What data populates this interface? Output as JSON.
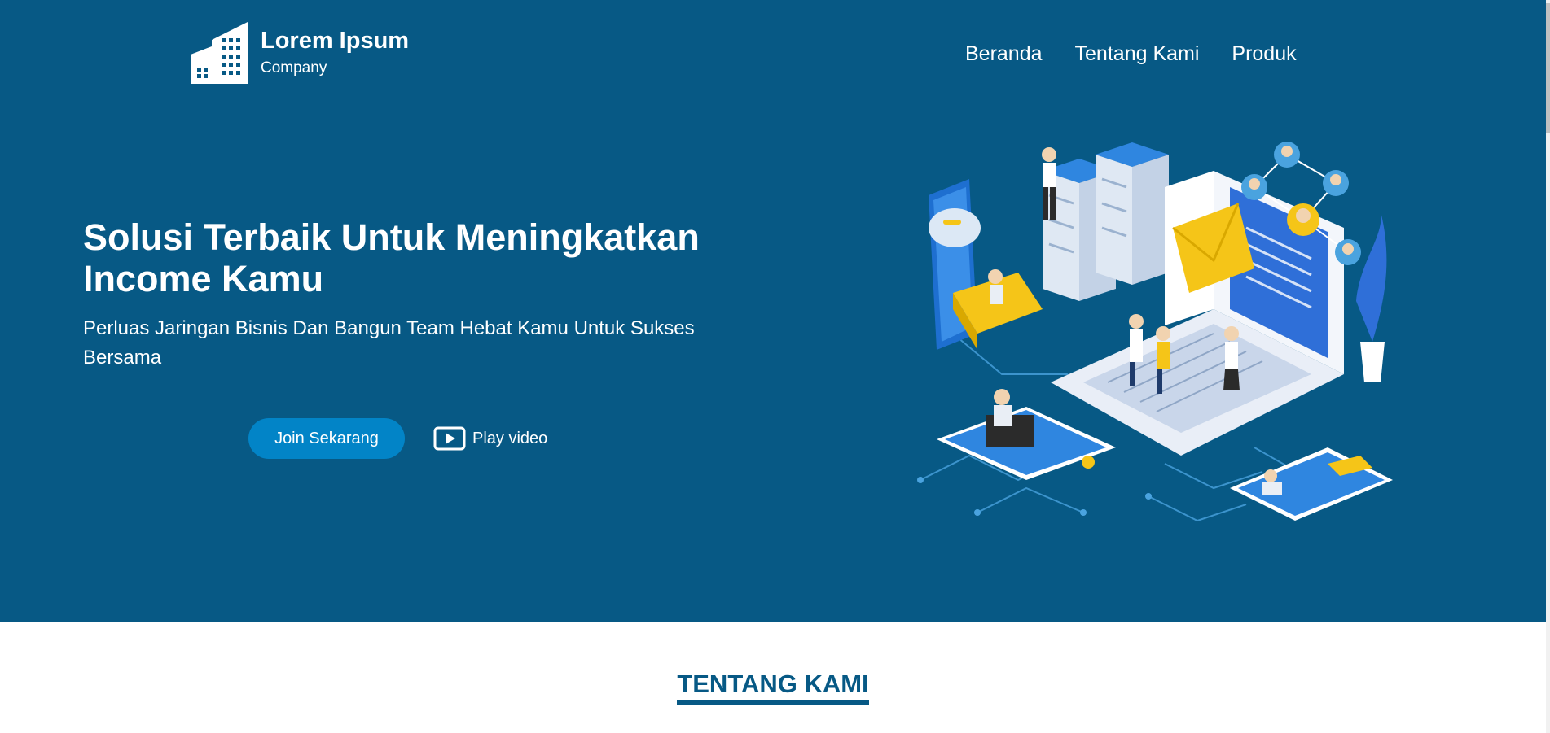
{
  "colors": {
    "hero_bg": "#075985",
    "button_bg": "#0284c7",
    "text_light": "#ffffff",
    "section_title": "#075985"
  },
  "logo": {
    "title": "Lorem Ipsum",
    "subtitle": "Company",
    "icon": "building-icon"
  },
  "nav": {
    "items": [
      {
        "label": "Beranda"
      },
      {
        "label": "Tentang Kami"
      },
      {
        "label": "Produk"
      }
    ]
  },
  "hero": {
    "title": "Solusi Terbaik Untuk Meningkatkan Income Kamu",
    "subtitle": "Perluas Jaringan Bisnis Dan Bangun Team Hebat Kamu Untuk Sukses Bersama",
    "join_label": "Join Sekarang",
    "play_label": "Play video",
    "play_icon": "play-icon",
    "illustration": "isometric-business-network-illustration"
  },
  "section": {
    "title": "TENTANG KAMI"
  }
}
